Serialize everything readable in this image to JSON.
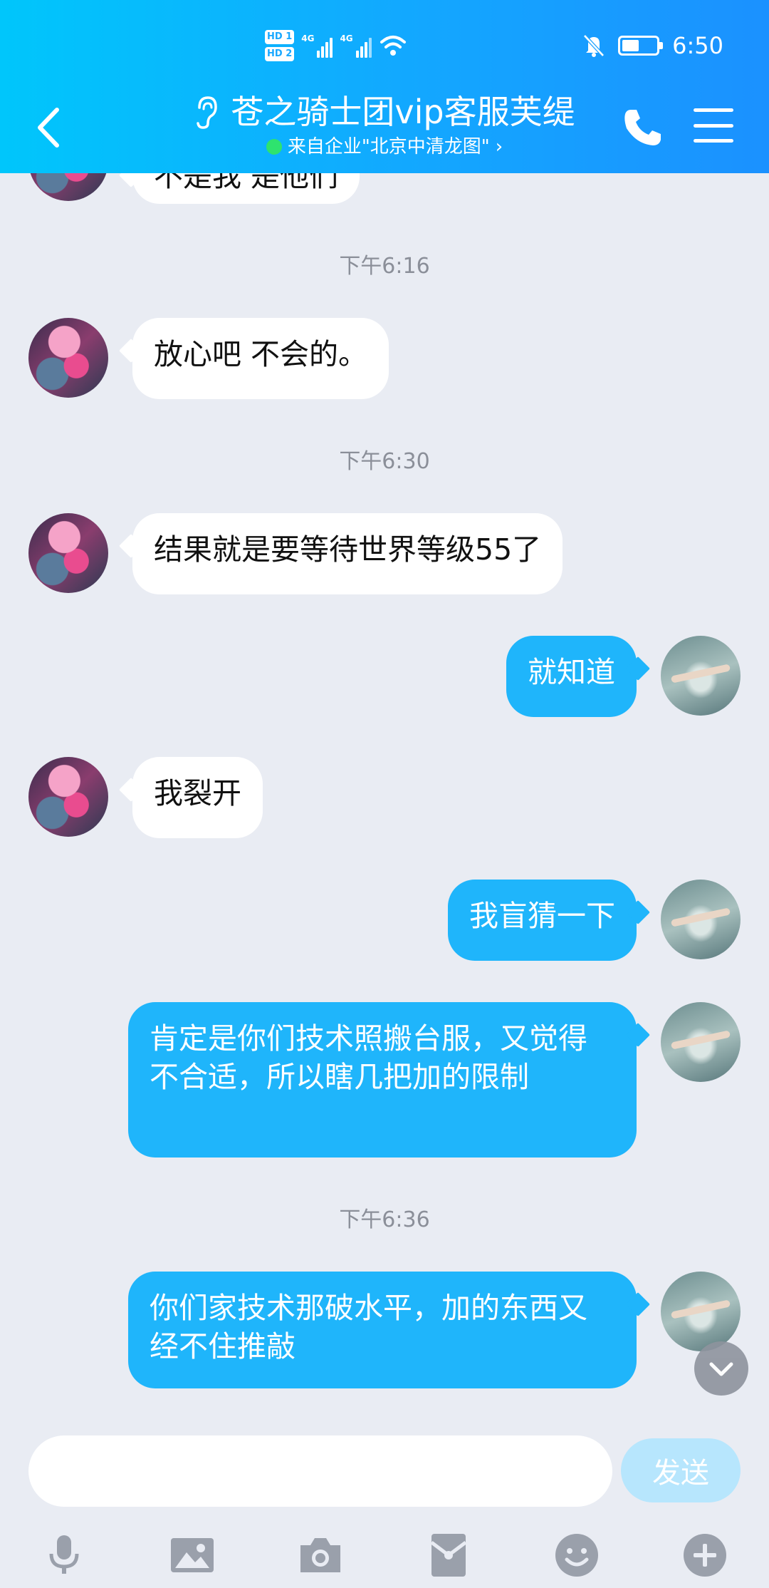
{
  "status_bar": {
    "hd1": "HD 1",
    "hd2": "HD 2",
    "net1": "4G",
    "net2": "4G",
    "time": "6:50",
    "battery_level": 0.5
  },
  "header": {
    "title": "苍之骑士团vip客服芙缇",
    "subtitle": "来自企业\"北京中清龙图\"",
    "subtitle_chevron": "›",
    "online_color": "#2ee36e"
  },
  "messages": {
    "partial_text": "不是我 是他们",
    "time1": "下午6:16",
    "m1": "放心吧 不会的。",
    "time2": "下午6:30",
    "m2": "结果就是要等待世界等级55了",
    "m3": "就知道",
    "m4": "我裂开",
    "m5": "我盲猜一下",
    "m6": "肯定是你们技术照搬台服，又觉得不合适，所以瞎几把加的限制",
    "time3": "下午6:36",
    "m7": "你们家技术那破水平，加的东西又经不住推敲"
  },
  "composer": {
    "placeholder": "",
    "send_label": "发送"
  },
  "toolbar_icons": [
    "microphone-icon",
    "image-icon",
    "camera-icon",
    "red-packet-icon",
    "emoji-icon",
    "plus-icon"
  ],
  "colors": {
    "header_start": "#00c6fb",
    "header_end": "#1b91ff",
    "outgoing_bubble": "#1fb5fb",
    "incoming_bubble": "#ffffff",
    "send_button": "#b7e6fd"
  }
}
